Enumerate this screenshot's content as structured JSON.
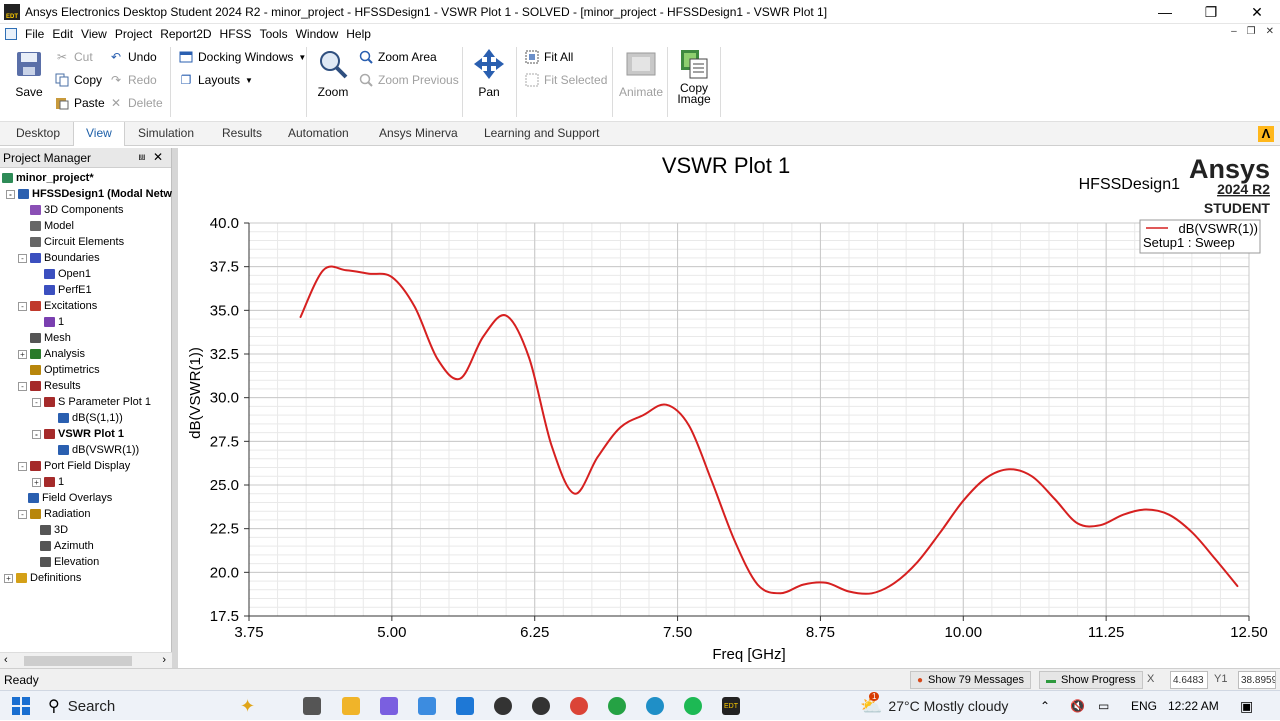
{
  "window": {
    "title": "Ansys Electronics Desktop Student 2024 R2 - minor_project - HFSSDesign1 - VSWR Plot 1 - SOLVED - [minor_project - HFSSDesign1 - VSWR Plot 1]",
    "app_icon_text": "EDT"
  },
  "menu": [
    "File",
    "Edit",
    "View",
    "Project",
    "Report2D",
    "HFSS",
    "Tools",
    "Window",
    "Help"
  ],
  "ribbon": {
    "save": "Save",
    "cut": "Cut",
    "copy": "Copy",
    "paste": "Paste",
    "undo": "Undo",
    "redo": "Redo",
    "delete": "Delete",
    "docking_windows": "Docking Windows",
    "layouts": "Layouts",
    "zoom": "Zoom",
    "zoom_area": "Zoom Area",
    "zoom_previous": "Zoom Previous",
    "pan": "Pan",
    "fit_all": "Fit All",
    "fit_selected": "Fit Selected",
    "animate": "Animate",
    "copy_image_line1": "Copy",
    "copy_image_line2": "Image"
  },
  "ribbon_tabs": [
    "Desktop",
    "View",
    "Simulation",
    "Results",
    "Automation",
    "Ansys Minerva",
    "Learning and Support"
  ],
  "active_tab": "View",
  "project_manager": {
    "header": "Project Manager",
    "tree": [
      {
        "label": "minor_project*",
        "bold": true,
        "color": "#2e8b57"
      },
      {
        "label": "HFSSDesign1 (Modal Netw",
        "bold": true,
        "color": "#2a5fb0"
      },
      {
        "label": "3D Components",
        "bold": false,
        "color": "#8a4fb5"
      },
      {
        "label": "Model",
        "bold": false,
        "color": "#666666"
      },
      {
        "label": "Circuit Elements",
        "bold": false,
        "color": "#666666"
      },
      {
        "label": "Boundaries",
        "bold": false,
        "color": "#3b4fbf"
      },
      {
        "label": "Open1",
        "bold": false,
        "color": "#3b4fbf"
      },
      {
        "label": "PerfE1",
        "bold": false,
        "color": "#3b4fbf"
      },
      {
        "label": "Excitations",
        "bold": false,
        "color": "#c0392b"
      },
      {
        "label": "1",
        "bold": false,
        "color": "#7a3fb0"
      },
      {
        "label": "Mesh",
        "bold": false,
        "color": "#555555"
      },
      {
        "label": "Analysis",
        "bold": false,
        "color": "#2a7a2a"
      },
      {
        "label": "Optimetrics",
        "bold": false,
        "color": "#b8860b"
      },
      {
        "label": "Results",
        "bold": false,
        "color": "#a52a2a"
      },
      {
        "label": "S Parameter Plot 1",
        "bold": false,
        "color": "#a52a2a"
      },
      {
        "label": "dB(S(1,1))",
        "bold": false,
        "color": "#2a5fb0"
      },
      {
        "label": "VSWR Plot 1",
        "bold": true,
        "color": "#a52a2a"
      },
      {
        "label": "dB(VSWR(1))",
        "bold": false,
        "color": "#2a5fb0"
      },
      {
        "label": "Port Field Display",
        "bold": false,
        "color": "#a52a2a"
      },
      {
        "label": "1",
        "bold": false,
        "color": "#a52a2a"
      },
      {
        "label": "Field Overlays",
        "bold": false,
        "color": "#2a5fb0"
      },
      {
        "label": "Radiation",
        "bold": false,
        "color": "#b8860b"
      },
      {
        "label": "3D",
        "bold": false,
        "color": "#555555"
      },
      {
        "label": "Azimuth",
        "bold": false,
        "color": "#555555"
      },
      {
        "label": "Elevation",
        "bold": false,
        "color": "#555555"
      },
      {
        "label": "Definitions",
        "bold": false,
        "color": "#d4a017"
      }
    ]
  },
  "plot": {
    "design_name": "HFSSDesign1",
    "brand": "Ansys",
    "version": "2024 R2",
    "edition": "STUDENT",
    "legend_line1": "dB(VSWR(1))",
    "legend_line2": "Setup1 : Sweep",
    "trace_color": "#d62020"
  },
  "chart_data": {
    "type": "line",
    "title": "VSWR Plot 1",
    "xlabel": "Freq [GHz]",
    "ylabel": "dB(VSWR(1))",
    "xlim": [
      3.75,
      12.5
    ],
    "ylim": [
      17.5,
      40.0
    ],
    "xticks": [
      "3.75",
      "5.00",
      "6.25",
      "7.50",
      "8.75",
      "10.00",
      "11.25",
      "12.50"
    ],
    "yticks": [
      "17.5",
      "20.0",
      "22.5",
      "25.0",
      "27.5",
      "30.0",
      "32.5",
      "35.0",
      "37.5",
      "40.0"
    ],
    "grid": true,
    "legend_position": "top-right",
    "series": [
      {
        "name": "dB(VSWR(1))",
        "x": [
          4.2,
          4.4,
          4.6,
          4.8,
          5.0,
          5.2,
          5.4,
          5.6,
          5.8,
          6.0,
          6.2,
          6.4,
          6.6,
          6.8,
          7.0,
          7.2,
          7.4,
          7.6,
          7.8,
          8.0,
          8.2,
          8.4,
          8.6,
          8.8,
          9.0,
          9.2,
          9.4,
          9.6,
          9.8,
          10.0,
          10.2,
          10.4,
          10.6,
          10.8,
          11.0,
          11.2,
          11.4,
          11.6,
          11.8,
          12.0,
          12.2,
          12.4
        ],
        "y": [
          34.6,
          37.3,
          37.3,
          37.1,
          36.9,
          35.2,
          32.2,
          31.1,
          33.5,
          34.7,
          32.3,
          27.2,
          24.5,
          26.6,
          28.3,
          29.0,
          29.6,
          28.4,
          25.2,
          21.8,
          19.3,
          18.8,
          19.3,
          19.4,
          18.9,
          18.8,
          19.4,
          20.6,
          22.3,
          24.1,
          25.4,
          25.9,
          25.5,
          24.2,
          22.8,
          22.7,
          23.3,
          23.6,
          23.3,
          22.3,
          20.8,
          19.2
        ]
      }
    ]
  },
  "status": {
    "ready": "Ready",
    "messages": "Show 79 Messages",
    "progress": "Show Progress",
    "x_label": "X",
    "x_value": "4.6483",
    "y_label": "Y1",
    "y_value": "38.8959"
  },
  "taskbar": {
    "search": "Search",
    "weather": "27°C  Mostly cloudy",
    "lang": "ENG",
    "time": "12:22 AM",
    "badge": "1"
  }
}
